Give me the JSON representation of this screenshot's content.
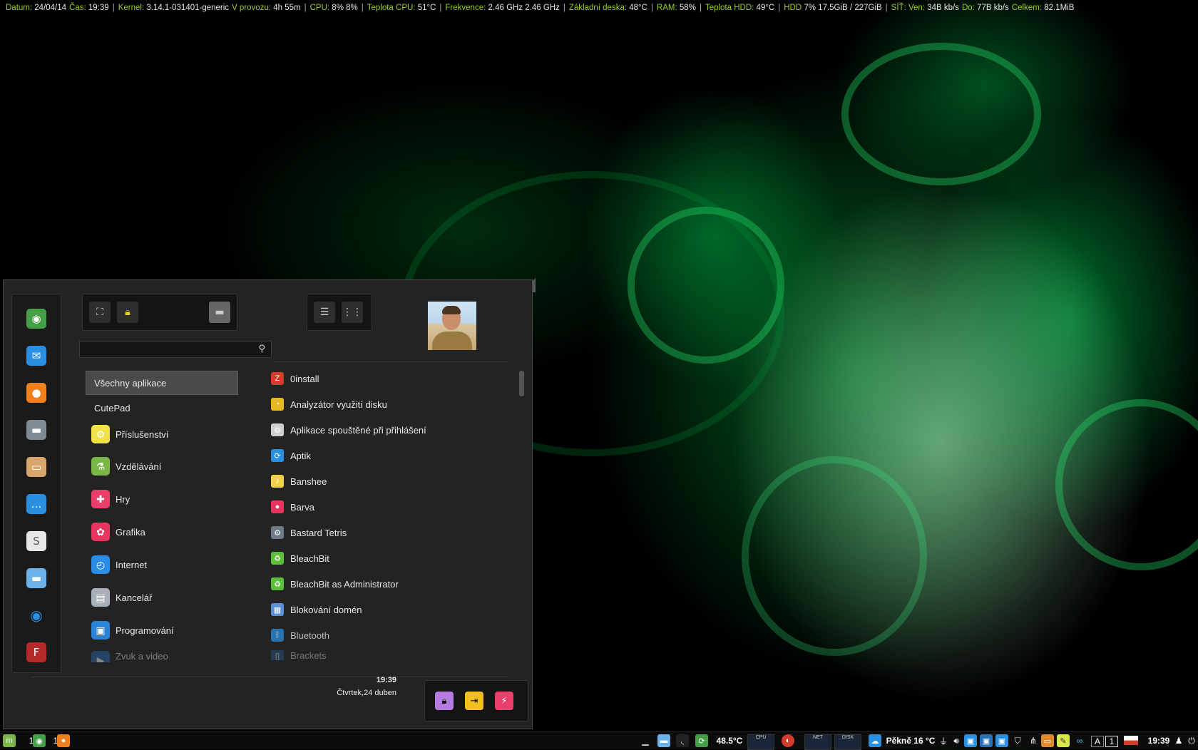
{
  "topbar": {
    "segments": [
      {
        "k": "Datum:",
        "v": "24/04/14"
      },
      {
        "k": "Čas:",
        "v": "19:39",
        "sep": "|"
      },
      {
        "k": "Kernel:",
        "v": "3.14.1-031401-generic"
      },
      {
        "k": "V provozu:",
        "v": "4h 55m",
        "sep": "|"
      },
      {
        "k": "CPU:",
        "v": "8% 8%",
        "sep": "|"
      },
      {
        "k": "Teplota CPU:",
        "v": "51°C",
        "sep": "|"
      },
      {
        "k": "Frekvence:",
        "v": "2.46 GHz 2.46 GHz",
        "sep": "|"
      },
      {
        "k": "Základní deska:",
        "v": "48°C",
        "sep": "|"
      },
      {
        "k": "RAM:",
        "v": "58%",
        "sep": "|"
      },
      {
        "k": "Teplota HDD:",
        "v": "49°C",
        "sep": "|"
      },
      {
        "k": "HDD",
        "v": "7% 17.5GiB / 227GiB",
        "sep": "|"
      },
      {
        "k": "SÍŤ: Ven:",
        "v": "34B   kb/s"
      },
      {
        "k": "Do:",
        "v": "77B   kb/s"
      },
      {
        "k": "Celkem:",
        "v": "82.1MiB"
      }
    ]
  },
  "menu": {
    "search": {
      "value": "",
      "placeholder": ""
    },
    "categories": [
      {
        "label": "Všechny aplikace",
        "selected": true
      },
      {
        "label": "CutePad"
      },
      {
        "label": "Příslušenství",
        "icon": "gear-icon",
        "color": "#f2e24a"
      },
      {
        "label": "Vzdělávání",
        "icon": "flask-icon",
        "color": "#7ab648"
      },
      {
        "label": "Hry",
        "icon": "gamepad-icon",
        "color": "#ea3f6a"
      },
      {
        "label": "Grafika",
        "icon": "paint-icon",
        "color": "#e8355d"
      },
      {
        "label": "Internet",
        "icon": "compass-icon",
        "color": "#2b8de6"
      },
      {
        "label": "Kancelář",
        "icon": "document-icon",
        "color": "#a9b0b7"
      },
      {
        "label": "Programování",
        "icon": "terminal-icon",
        "color": "#2a83d6"
      },
      {
        "label": "Zvuk a video",
        "icon": "media-icon",
        "color": "#2a6fb8"
      }
    ],
    "apps": [
      {
        "label": "0install",
        "color": "#d33c2a",
        "glyph": "Z"
      },
      {
        "label": "Analyzátor využití disku",
        "color": "#e9b923",
        "glyph": "◔"
      },
      {
        "label": "Aplikace spouštěné při přihlášení",
        "color": "#cfcfcf",
        "glyph": "⚙"
      },
      {
        "label": "Aptik",
        "color": "#2a8fe0",
        "glyph": "⟳"
      },
      {
        "label": "Banshee",
        "color": "#f0d24a",
        "glyph": "♪"
      },
      {
        "label": "Barva",
        "color": "#e8355d",
        "glyph": "●"
      },
      {
        "label": "Bastard Tetris",
        "color": "#6e7a86",
        "glyph": "⚙"
      },
      {
        "label": "BleachBit",
        "color": "#5bbf3a",
        "glyph": "♻"
      },
      {
        "label": "BleachBit as Administrator",
        "color": "#5bbf3a",
        "glyph": "♻"
      },
      {
        "label": "Blokování domén",
        "color": "#5a8ed6",
        "glyph": "▦"
      },
      {
        "label": "Bluetooth",
        "color": "#2a8fe0",
        "glyph": "ᛒ"
      },
      {
        "label": "Brackets",
        "color": "#2a5f9a",
        "glyph": "[]"
      }
    ],
    "clock": {
      "time": "19:39",
      "date": "Čtvrtek,24 duben"
    }
  },
  "taskbar": {
    "workspace_a": "1",
    "workspace_b": "1",
    "cpu_temp": "48.5°C",
    "graph_cpu": "CPU",
    "graph_net": "NET",
    "graph_disk": "DISK",
    "weather": "Pěkně 16 °C",
    "keyboard": "A",
    "workspace_num": "1",
    "time": "19:39"
  }
}
